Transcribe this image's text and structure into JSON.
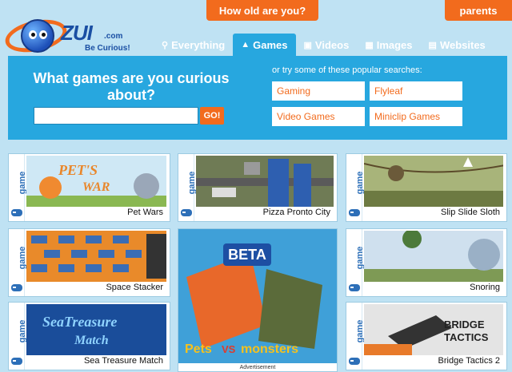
{
  "top": {
    "age_button": "How old are you?",
    "parents_button": "parents"
  },
  "logo": {
    "name": "ZUI",
    "domain": ".com",
    "tagline": "Be Curious!"
  },
  "nav": [
    {
      "label": "Everything",
      "icon": "search-icon"
    },
    {
      "label": "Games",
      "icon": "gamepad-icon",
      "active": true
    },
    {
      "label": "Videos",
      "icon": "video-icon"
    },
    {
      "label": "Images",
      "icon": "image-icon"
    },
    {
      "label": "Websites",
      "icon": "website-icon"
    }
  ],
  "search": {
    "question": "What games are you curious about?",
    "input_value": "",
    "go_label": "GO!",
    "popular_label": "or try some of these popular searches:",
    "popular": [
      "Gaming",
      "Flyleaf",
      "Video Games",
      "Miniclip Games"
    ]
  },
  "tiles": [
    {
      "side": "game",
      "title": "Pet Wars"
    },
    {
      "side": "game",
      "title": "Pizza Pronto City"
    },
    {
      "side": "game",
      "title": "Slip Slide Sloth"
    },
    {
      "side": "game",
      "title": "Space Stacker"
    },
    {
      "side": "game",
      "title": "Snoring"
    },
    {
      "side": "game",
      "title": "Sea Treasure Match"
    },
    {
      "side": "game",
      "title": "Bridge Tactics 2"
    }
  ],
  "ad": {
    "label": "Advertisement",
    "badge": "BETA",
    "title_left": "Pets",
    "title_vs": "VS",
    "title_right": "monsters"
  },
  "colors": {
    "orange": "#f26b1d",
    "panel_blue": "#27a7df",
    "bg_blue": "#bfe2f3",
    "link_blue": "#2d6fb8"
  }
}
